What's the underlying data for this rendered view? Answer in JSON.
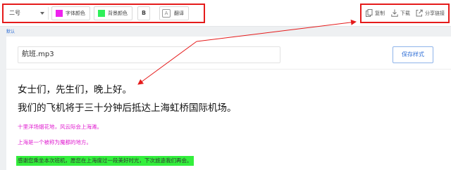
{
  "toolbar": {
    "font_size": "二号",
    "font_color": {
      "label": "字体颜色",
      "swatch": "#ee22ee"
    },
    "bg_color": {
      "label": "背景颜色",
      "swatch": "#2ff05a"
    },
    "bold_label": "B",
    "translate": {
      "icon_char": "A",
      "label": "翻译"
    }
  },
  "actions": {
    "copy_label": "复制",
    "download_label": "下载",
    "share_label": "分享链接"
  },
  "editor": {
    "default_tag": "默认",
    "file_name": "航班.mp3",
    "save_style_label": "保存样式",
    "lines": [
      "女士们，先生们，晚上好。",
      "我们的飞机将于三十分钟后抵达上海虹桥国际机场。",
      "十里洋场烟花地，风云际会上海滩。",
      "上海是一个被称为魔都的地方。",
      "感谢您乘坐本次班机，愿您在上海度过一段美好时光，下次旅途我们再会。"
    ]
  },
  "colors": {
    "annotation": "#e51b1b",
    "accent": "#2f6fd6",
    "magenta_text": "#e01ed0",
    "highlight": "#33ef3c"
  }
}
